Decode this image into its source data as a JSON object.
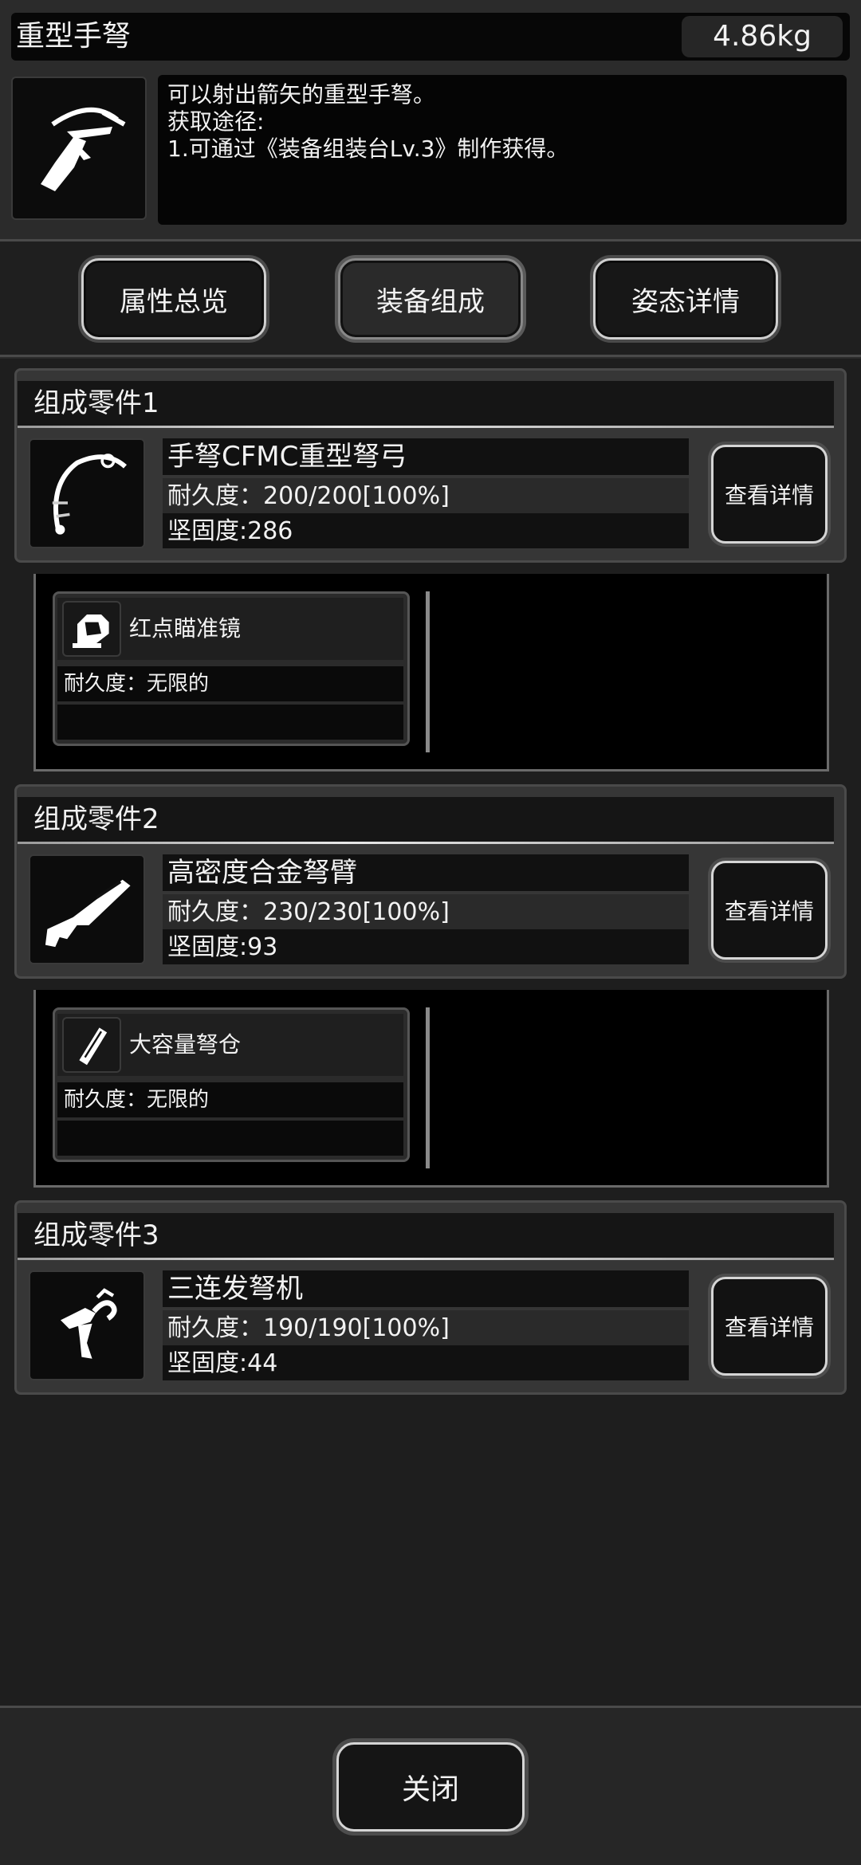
{
  "item": {
    "name": "重型手弩",
    "weight": "4.86kg",
    "description": [
      "可以射出箭矢的重型手弩。",
      "获取途径:",
      "1.可通过《装备组装台Lv.3》制作获得。"
    ],
    "icon": "crossbow-icon"
  },
  "tabs": [
    {
      "label": "属性总览",
      "active": false
    },
    {
      "label": "装备组成",
      "active": true
    },
    {
      "label": "姿态详情",
      "active": false
    }
  ],
  "parts": [
    {
      "header": "组成零件1",
      "name": "手弩CFMC重型弩弓",
      "durability": "耐久度：200/200[100%]",
      "hardness": "坚固度:286",
      "icon": "crossbow-bow-icon",
      "detail_label": "查看详情",
      "sub": {
        "name": "红点瞄准镜",
        "durability": "耐久度：无限的",
        "icon": "red-dot-sight-icon"
      }
    },
    {
      "header": "组成零件2",
      "name": "高密度合金弩臂",
      "durability": "耐久度：230/230[100%]",
      "hardness": "坚固度:93",
      "icon": "crossbow-stock-icon",
      "detail_label": "查看详情",
      "sub": {
        "name": "大容量弩仓",
        "durability": "耐久度：无限的",
        "icon": "magazine-icon"
      }
    },
    {
      "header": "组成零件3",
      "name": "三连发弩机",
      "durability": "耐久度：190/190[100%]",
      "hardness": "坚固度:44",
      "icon": "trigger-mechanism-icon",
      "detail_label": "查看详情"
    }
  ],
  "close_label": "关闭",
  "colors": {
    "background": "#2b2b2b",
    "panel": "#363636",
    "dark": "#050505",
    "border_light": "#d5d5d5"
  }
}
